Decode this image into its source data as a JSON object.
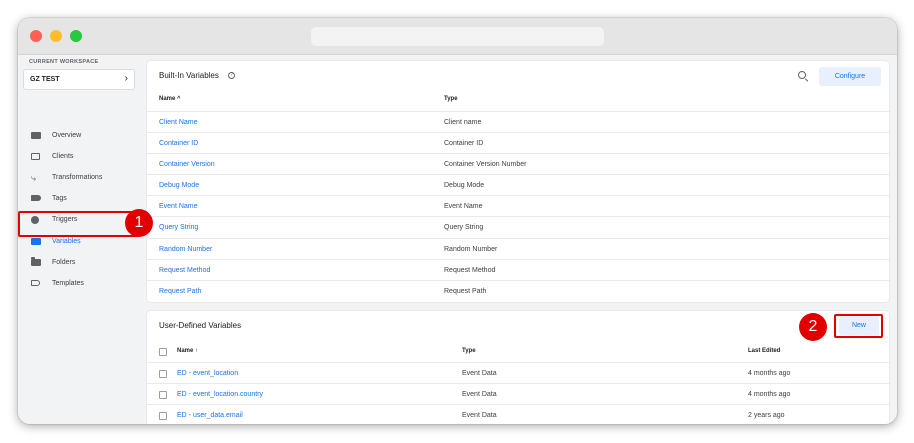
{
  "sidebar": {
    "workspace_label": "CURRENT WORKSPACE",
    "workspace_name": "GZ TEST",
    "items": [
      {
        "label": "Overview",
        "icon": "overview-icon"
      },
      {
        "label": "Clients",
        "icon": "clients-icon"
      },
      {
        "label": "Transformations",
        "icon": "transformations-icon"
      },
      {
        "label": "Tags",
        "icon": "tag-icon"
      },
      {
        "label": "Triggers",
        "icon": "trigger-icon"
      },
      {
        "label": "Variables",
        "icon": "variables-icon",
        "active": true
      },
      {
        "label": "Folders",
        "icon": "folder-icon"
      },
      {
        "label": "Templates",
        "icon": "template-icon"
      }
    ]
  },
  "builtin": {
    "title": "Built-In Variables",
    "configure_label": "Configure",
    "col_name": "Name",
    "col_type": "Type",
    "rows": [
      {
        "name": "Client Name",
        "type": "Client name"
      },
      {
        "name": "Container ID",
        "type": "Container ID"
      },
      {
        "name": "Container Version",
        "type": "Container Version Number"
      },
      {
        "name": "Debug Mode",
        "type": "Debug Mode"
      },
      {
        "name": "Event Name",
        "type": "Event Name"
      },
      {
        "name": "Query String",
        "type": "Query String"
      },
      {
        "name": "Random Number",
        "type": "Random Number"
      },
      {
        "name": "Request Method",
        "type": "Request Method"
      },
      {
        "name": "Request Path",
        "type": "Request Path"
      }
    ]
  },
  "userdefined": {
    "title": "User-Defined Variables",
    "new_label": "New",
    "col_name": "Name",
    "col_type": "Type",
    "col_edited": "Last Edited",
    "rows": [
      {
        "name": "ED - event_location",
        "type": "Event Data",
        "edited": "4 months ago"
      },
      {
        "name": "ED - event_location.country",
        "type": "Event Data",
        "edited": "4 months ago"
      },
      {
        "name": "ED - user_data.email",
        "type": "Event Data",
        "edited": "2 years ago"
      }
    ]
  },
  "annotations": {
    "badge1": "1",
    "badge2": "2",
    "highlight_color": "#e00000"
  },
  "colors": {
    "accent": "#1a73e8",
    "annotation": "#e00000"
  }
}
